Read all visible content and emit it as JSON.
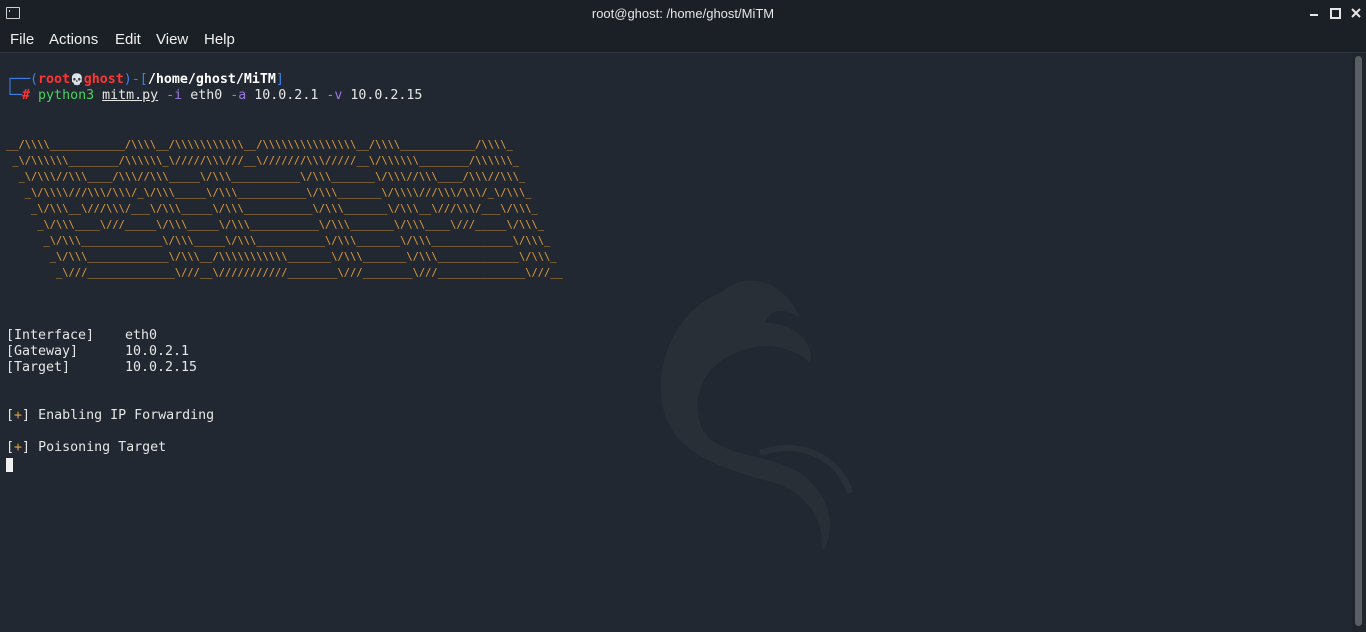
{
  "window": {
    "title": "root@ghost: /home/ghost/MiTM"
  },
  "menu": {
    "items": [
      "File",
      "Actions",
      "Edit",
      "View",
      "Help"
    ]
  },
  "prompt": {
    "open_paren": "┌──(",
    "user": "root",
    "skull": "💀",
    "host": "ghost",
    "close_paren": ")-[",
    "path": "/home/ghost/MiTM",
    "close_bracket": "]",
    "line2_prefix": "└─",
    "hash": "#",
    "command": "python3",
    "script": "mitm.py",
    "flag_i": "-i",
    "iface": "eth0",
    "flag_a": "-a",
    "gateway_ip": "10.0.2.1",
    "flag_v": "-v",
    "target_ip": "10.0.2.15"
  },
  "ascii_art": "__/\\\\\\\\____________/\\\\\\\\__/\\\\\\\\\\\\\\\\\\\\\\__/\\\\\\\\\\\\\\\\\\\\\\\\\\\\\\__/\\\\\\\\____________/\\\\\\\\_\n _\\/\\\\\\\\\\\\________/\\\\\\\\\\\\_\\/////\\\\\\///__\\///////\\\\\\/////__\\/\\\\\\\\\\\\________/\\\\\\\\\\\\_\n  _\\/\\\\\\//\\\\\\____/\\\\\\//\\\\\\_____\\/\\\\\\___________\\/\\\\\\_______\\/\\\\\\//\\\\\\____/\\\\\\//\\\\\\_\n   _\\/\\\\\\\\///\\\\\\/\\\\\\/_\\/\\\\\\_____\\/\\\\\\___________\\/\\\\\\_______\\/\\\\\\\\///\\\\\\/\\\\\\/_\\/\\\\\\_\n    _\\/\\\\\\__\\///\\\\\\/___\\/\\\\\\_____\\/\\\\\\___________\\/\\\\\\_______\\/\\\\\\__\\///\\\\\\/___\\/\\\\\\_\n     _\\/\\\\\\____\\///_____\\/\\\\\\_____\\/\\\\\\___________\\/\\\\\\_______\\/\\\\\\____\\///_____\\/\\\\\\_\n      _\\/\\\\\\_____________\\/\\\\\\_____\\/\\\\\\___________\\/\\\\\\_______\\/\\\\\\_____________\\/\\\\\\_\n       _\\/\\\\\\_____________\\/\\\\\\__/\\\\\\\\\\\\\\\\\\\\\\_______\\/\\\\\\_______\\/\\\\\\_____________\\/\\\\\\_\n        _\\///______________\\///__\\///////////________\\///________\\///______________\\///__",
  "info": {
    "interface_label": "[Interface]",
    "interface_value": "eth0",
    "gateway_label": "[Gateway]",
    "gateway_value": "10.0.2.1",
    "target_label": "[Target]",
    "target_value": "10.0.2.15"
  },
  "status": {
    "bracket_open": "[",
    "plus": "+",
    "bracket_close": "]",
    "msg1": "Enabling IP Forwarding",
    "msg2": "Poisoning Target"
  }
}
